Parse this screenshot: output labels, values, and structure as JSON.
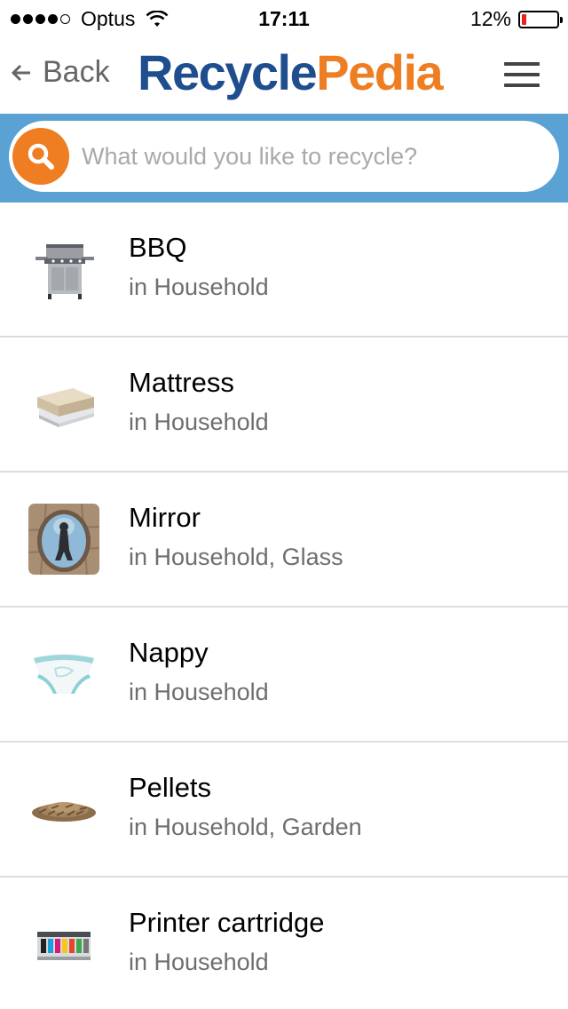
{
  "status_bar": {
    "carrier": "Optus",
    "time": "17:11",
    "battery_percent": "12%",
    "battery_level": 0.12,
    "battery_color": "#e8231f"
  },
  "nav": {
    "back_label": "Back",
    "logo_part1": "Recycle",
    "logo_part2": "Pedia",
    "logo_color1": "#1f4e8e",
    "logo_color2": "#ef7d22"
  },
  "search": {
    "placeholder": "What would you like to recycle?",
    "value": "",
    "band_color": "#5aa1d4"
  },
  "items": [
    {
      "title": "BBQ",
      "subtitle": "in Household",
      "icon": "bbq-icon"
    },
    {
      "title": "Mattress",
      "subtitle": "in Household",
      "icon": "mattress-icon"
    },
    {
      "title": "Mirror",
      "subtitle": "in Household, Glass",
      "icon": "mirror-icon"
    },
    {
      "title": "Nappy",
      "subtitle": "in Household",
      "icon": "nappy-icon"
    },
    {
      "title": "Pellets",
      "subtitle": "in Household, Garden",
      "icon": "pellets-icon"
    },
    {
      "title": "Printer cartridge",
      "subtitle": "in Household",
      "icon": "printer-cartridge-icon"
    }
  ]
}
